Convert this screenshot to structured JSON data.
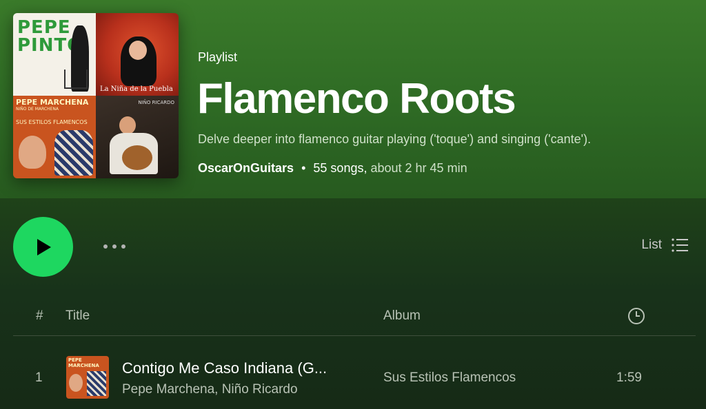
{
  "playlist": {
    "type_label": "Playlist",
    "title": "Flamenco Roots",
    "description": "Delve deeper into flamenco guitar playing ('toque') and singing ('cante').",
    "owner": "OscarOnGuitars",
    "separator": "•",
    "song_count": "55 songs,",
    "duration": "about 2 hr 45 min",
    "cover_tiles": [
      {
        "text": "PEPE PINTO"
      },
      {
        "text": "La Niña de la Puebla"
      },
      {
        "text": "PEPE MARCHENA",
        "subtext": "NIÑO DE MARCHENA",
        "subtext2": "SUS ESTILOS FLAMENCOS"
      },
      {
        "text": "NIÑO RICARDO"
      }
    ]
  },
  "action_bar": {
    "view_label": "List"
  },
  "table": {
    "headers": {
      "number": "#",
      "title": "Title",
      "album": "Album"
    },
    "tracks": [
      {
        "number": "1",
        "title": "Contigo Me Caso Indiana (G...",
        "artists": "Pepe Marchena, Niño Ricardo",
        "album": "Sus Estilos Flamencos",
        "duration": "1:59",
        "art_text": "PEPE MARCHENA"
      }
    ]
  },
  "colors": {
    "accent": "#1ed760",
    "header_green": "#3a7a2a"
  }
}
